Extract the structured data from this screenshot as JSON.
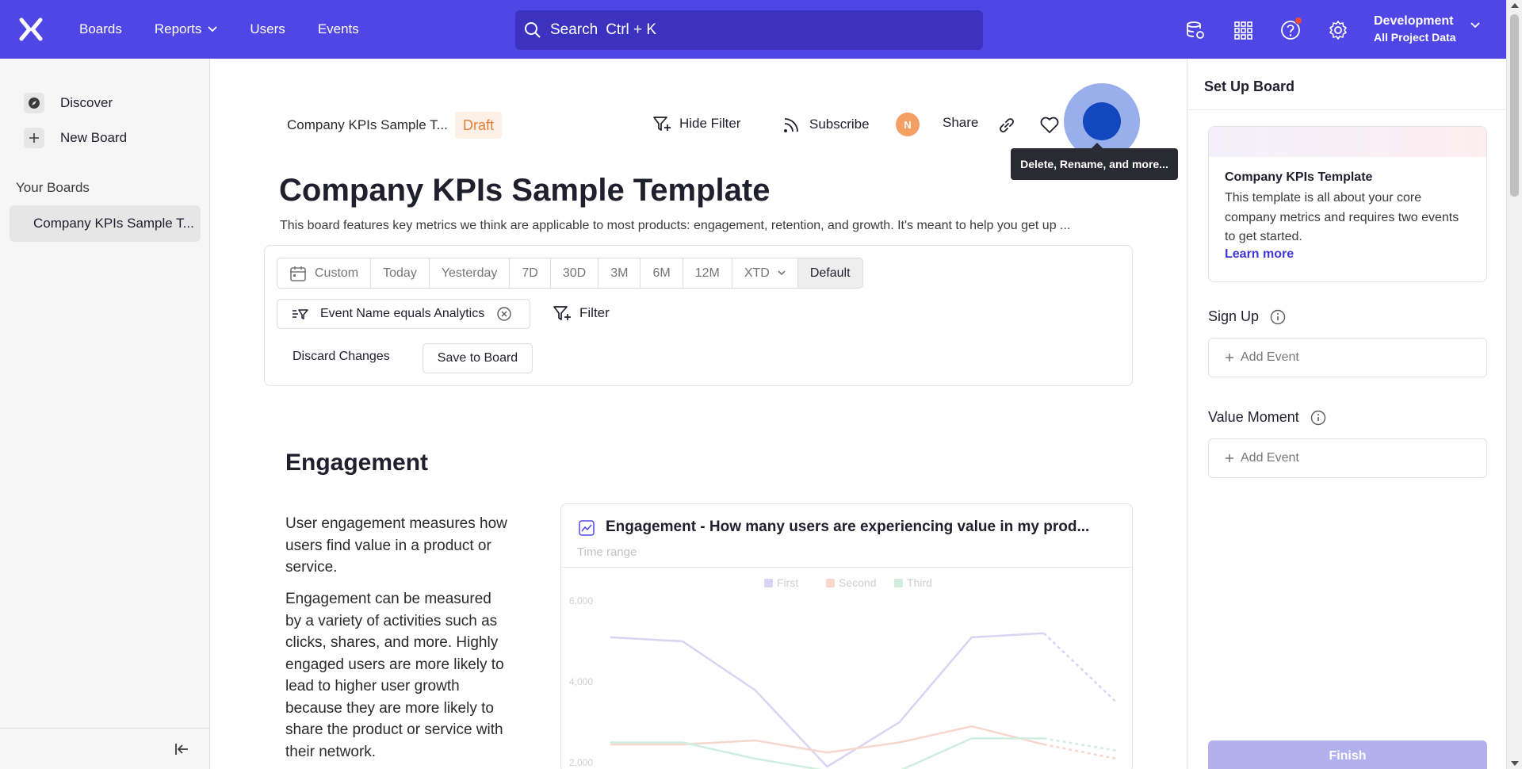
{
  "topbar": {
    "nav": [
      "Boards",
      "Reports",
      "Users",
      "Events"
    ],
    "search_label": "Search",
    "search_shortcut": "Ctrl + K",
    "project_name": "Development",
    "project_scope": "All Project Data",
    "icons": [
      "data-settings-icon",
      "apps-grid-icon",
      "help-icon",
      "gear-icon"
    ],
    "accent": "#5046e5"
  },
  "sidebar": {
    "discover": "Discover",
    "new_board": "New Board",
    "heading": "Your Boards",
    "boards": [
      "Company KPIs Sample T..."
    ]
  },
  "header": {
    "breadcrumb": "Company KPIs Sample T...",
    "badge": "Draft",
    "hide_filter": "Hide Filter",
    "subscribe": "Subscribe",
    "avatar_initial": "N",
    "share": "Share",
    "tooltip": "Delete, Rename, and more..."
  },
  "board": {
    "title": "Company KPIs Sample Template",
    "description": "This board features key metrics we think are applicable to most products: engagement, retention, and growth. It's meant to help you get up ..."
  },
  "filters": {
    "date_ranges": [
      "Custom",
      "Today",
      "Yesterday",
      "7D",
      "30D",
      "3M",
      "6M",
      "12M",
      "XTD",
      "Default"
    ],
    "active_range": "Default",
    "chip_label": "Event Name equals Analytics",
    "filter_label": "Filter",
    "discard": "Discard Changes",
    "save": "Save to Board"
  },
  "engagement": {
    "heading": "Engagement",
    "para1": "User engagement measures how users find value in a product or service.",
    "para2": "Engagement can be measured by a variety of activities such as clicks, shares, and more. Highly engaged users are more likely to lead to higher user growth because they are more likely to share the product or service with their network.",
    "card_title": "Engagement - How many users are experiencing value in my prod...",
    "card_subtitle": "Time range"
  },
  "chart_data": {
    "type": "line",
    "x": [
      0,
      1,
      2,
      3,
      4,
      5,
      6,
      7
    ],
    "series": [
      {
        "name": "First",
        "values": [
          5100,
          5000,
          3800,
          1900,
          3000,
          5100,
          5200,
          3500
        ],
        "color": "#d8d4f4"
      },
      {
        "name": "Second",
        "values": [
          2450,
          2450,
          2550,
          2250,
          2500,
          2900,
          2450,
          2100
        ],
        "color": "#f7d6cc"
      },
      {
        "name": "Third",
        "values": [
          2500,
          2500,
          2100,
          1800,
          1800,
          2600,
          2600,
          2300
        ],
        "color": "#cfeee0"
      }
    ],
    "ylim": [
      2000,
      6000
    ],
    "yticks": [
      "2,000",
      "4,000",
      "6,000"
    ],
    "legend": "top-center",
    "faded": true
  },
  "setup": {
    "title": "Set Up Board",
    "template_name": "Company KPIs Template",
    "template_desc": "This template is all about your core company metrics and requires two events to get started.",
    "learn_more": "Learn more",
    "sign_up": "Sign Up",
    "value_moment": "Value Moment",
    "add_event": "Add Event",
    "finish": "Finish"
  }
}
